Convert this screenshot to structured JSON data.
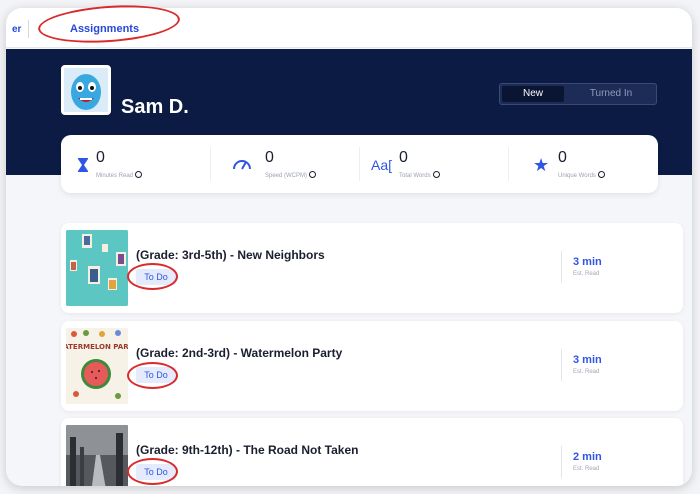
{
  "tabs": {
    "previous_partial": "er",
    "active": "Assignments"
  },
  "profile": {
    "name": "Sam D."
  },
  "toggle": {
    "new_label": "New",
    "turned_in_label": "Turned In"
  },
  "stats": [
    {
      "icon": "hourglass-icon",
      "value": "0",
      "label": "Minutes Read"
    },
    {
      "icon": "speedometer-icon",
      "value": "0",
      "label": "Speed (WCPM)"
    },
    {
      "icon": "text-size-icon",
      "value": "0",
      "label": "Total Words"
    },
    {
      "icon": "star-icon",
      "value": "0",
      "label": "Unique Words"
    }
  ],
  "assignments": [
    {
      "title": "(Grade: 3rd-5th) - New Neighbors",
      "status": "To Do",
      "minutes": "3 min",
      "est_label": "Est. Read"
    },
    {
      "title": "(Grade: 2nd-3rd) - Watermelon Party",
      "status": "To Do",
      "minutes": "3 min",
      "est_label": "Est. Read",
      "cover_text": "WATERMELON PARTY"
    },
    {
      "title": "(Grade: 9th-12th) - The Road Not Taken",
      "status": "To Do",
      "minutes": "2 min",
      "est_label": "Est. Read"
    }
  ],
  "colors": {
    "accent": "#2f55e4",
    "hero": "#0c1b44",
    "annotation": "#d92b2b"
  }
}
